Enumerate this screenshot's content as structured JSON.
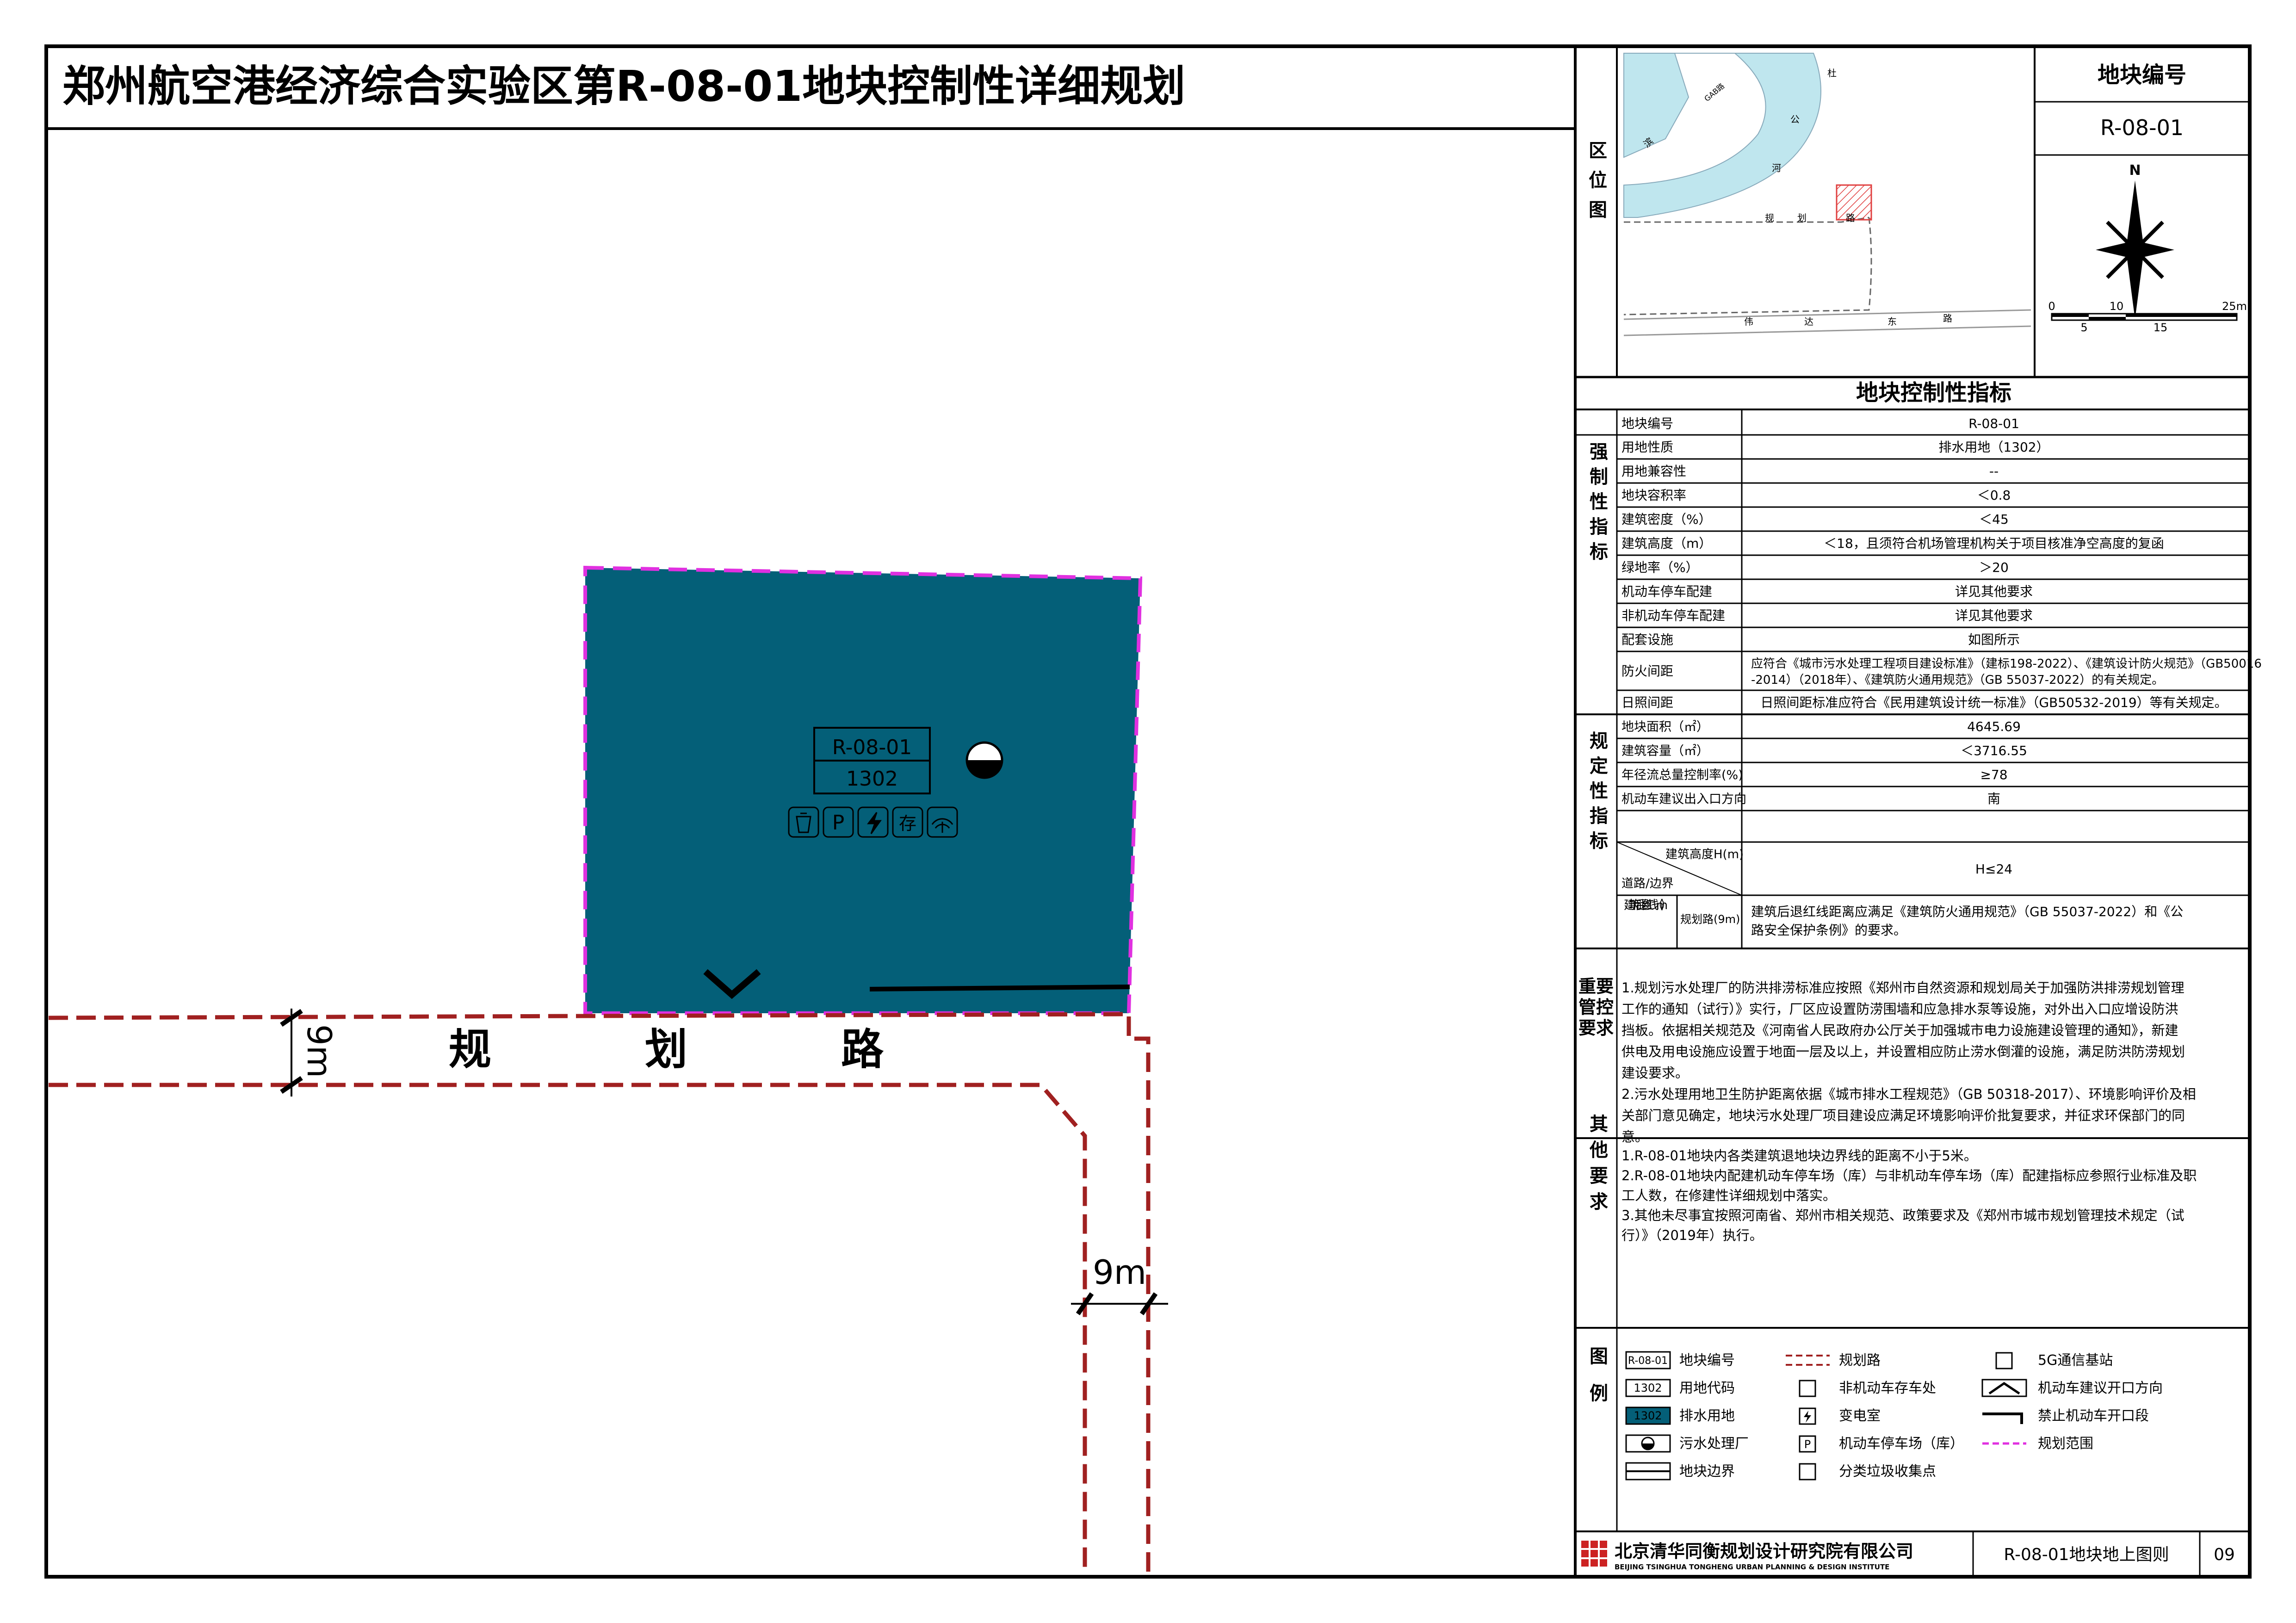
{
  "title": "郑州航空港经济综合实验区第R-08-01地块控制性详细规划",
  "map": {
    "parcel_code": "R-08-01",
    "land_code": "1302",
    "road_label": "规　划　路",
    "width_label_1": "9m",
    "width_label_2": "9m",
    "facility_icons": [
      "trash-collection-icon",
      "parking-icon",
      "substation-icon",
      "bike-parking-icon",
      "telecom-5g-icon"
    ],
    "facility_icon_text": {
      "parking": "P",
      "bike": "存"
    }
  },
  "location": {
    "section_label": "区位图",
    "road_chars": [
      "规",
      "划",
      "路"
    ],
    "river_chars": [
      "杜",
      "公",
      "河"
    ],
    "bottom_road_chars": [
      "伟",
      "达",
      "东",
      "路"
    ],
    "left_road_chars": [
      "滨",
      "路"
    ],
    "river_road_text": "GAB路"
  },
  "parcel_no": {
    "header": "地块编号",
    "value": "R-08-01"
  },
  "compass": {
    "north": "N",
    "scale": [
      "0",
      "10",
      "25m",
      "5",
      "15"
    ]
  },
  "indicators": {
    "title": "地块控制性指标",
    "row_parcel": {
      "label": "地块编号",
      "value": "R-08-01"
    },
    "mandatory_label": "强制性指标",
    "mandatory": [
      {
        "label": "用地性质",
        "value": "排水用地（1302）"
      },
      {
        "label": "用地兼容性",
        "value": "--"
      },
      {
        "label": "地块容积率",
        "value": "＜0.8"
      },
      {
        "label": "建筑密度（%）",
        "value": "＜45"
      },
      {
        "label": "建筑高度（m）",
        "value": "＜18，且须符合机场管理机构关于项目核准净空高度的复函"
      },
      {
        "label": "绿地率（%）",
        "value": "＞20"
      },
      {
        "label": "机动车停车配建",
        "value": "详见其他要求"
      },
      {
        "label": "非机动车停车配建",
        "value": "详见其他要求"
      },
      {
        "label": "配套设施",
        "value": "如图所示"
      },
      {
        "label": "防火间距",
        "value": "应符合《城市污水处理工程项目建设标准》（建标198-2022）、《建筑设计防火规范》（GB50016-2014）（2018年）、《建筑防火通用规范》（GB 55037-2022）的有关规定。"
      },
      {
        "label": "日照间距",
        "value": "日照间距标准应符合《民用建筑设计统一标准》（GB50532-2019）等有关规定。"
      }
    ],
    "regulatory_label": "规定性指标",
    "regulatory": [
      {
        "label": "地块面积（㎡）",
        "value": "4645.69"
      },
      {
        "label": "建筑容量（㎡）",
        "value": "＜3716.55"
      },
      {
        "label": "年径流总量控制率(%)",
        "value": "≥78"
      },
      {
        "label": "机动车建议出入口方向",
        "value": "南"
      }
    ],
    "height_row": {
      "label_top": "建筑高度H(m)",
      "label_bottom": "道路/边界",
      "value": "H≤24"
    },
    "setback_row": {
      "label": "建筑后退红线（m）",
      "sub": "规划路(9m)",
      "value": "建筑后退红线距离应满足《建筑防火通用规范》（GB 55037-2022）和《公路安全保护条例》的要求。"
    }
  },
  "important": {
    "label": "重要管控要求",
    "lines": [
      "1.规划污水处理厂的防洪排涝标准应按照《郑州市自然资源和规划局关于加强防洪排涝规划管理",
      "工作的通知（试行）》实行，厂区应设置防涝围墙和应急排水泵等设施，对外出入口应增设防洪",
      "挡板。依据相关规范及《河南省人民政府办公厅关于加强城市电力设施建设管理的通知》，新建",
      "供电及用电设施应设置于地面一层及以上，并设置相应防止涝水倒灌的设施，满足防洪防涝规划",
      "建设要求。",
      "2.污水处理用地卫生防护距离依据《城市排水工程规范》（GB 50318-2017）、环境影响评价及相",
      "关部门意见确定，地块污水处理厂项目建设应满足环境影响评价批复要求，并征求环保部门的同",
      "意。"
    ]
  },
  "other": {
    "label": "其他要求",
    "lines": [
      "1.R-08-01地块内各类建筑退地块边界线的距离不小于5米。",
      "2.R-08-01地块内配建机动车停车场（库）与非机动车停车场（库）配建指标应参照行业标准及职",
      "工人数，在修建性详细规划中落实。",
      "3.其他未尽事宜按照河南省、郑州市相关规范、政策要求及《郑州市城市规划管理技术规定（试",
      "行）》（2019年）执行。"
    ]
  },
  "legend": {
    "label": "图例",
    "items": [
      {
        "sym": "R-08-01",
        "text": "地块编号"
      },
      {
        "sym": "1302",
        "text": "用地代码"
      },
      {
        "sym": "1302",
        "text": "排水用地"
      },
      {
        "sym": "",
        "text": "污水处理厂"
      },
      {
        "sym": "",
        "text": "地块边界"
      },
      {
        "sym": "",
        "text": "规划路"
      },
      {
        "sym": "",
        "text": "非机动车存车处"
      },
      {
        "sym": "",
        "text": "变电室"
      },
      {
        "sym": "P",
        "text": "机动车停车场（库）"
      },
      {
        "sym": "",
        "text": "分类垃圾收集点"
      },
      {
        "sym": "",
        "text": "5G通信基站"
      },
      {
        "sym": "",
        "text": "机动车建议开口方向"
      },
      {
        "sym": "",
        "text": "禁止机动车开口段"
      },
      {
        "sym": "",
        "text": "规划范围"
      }
    ]
  },
  "footer": {
    "company_cn": "北京清华同衡规划设计研究院有限公司",
    "company_en": "BEIJING TSINGHUA TONGHENG URBAN PLANNING & DESIGN INSTITUTE",
    "drawing_name": "R-08-01地块地上图则",
    "page": "09"
  },
  "colors": {
    "drainage": "#045f78",
    "road_red": "#a02020",
    "boundary_magenta": "#e030e0"
  }
}
